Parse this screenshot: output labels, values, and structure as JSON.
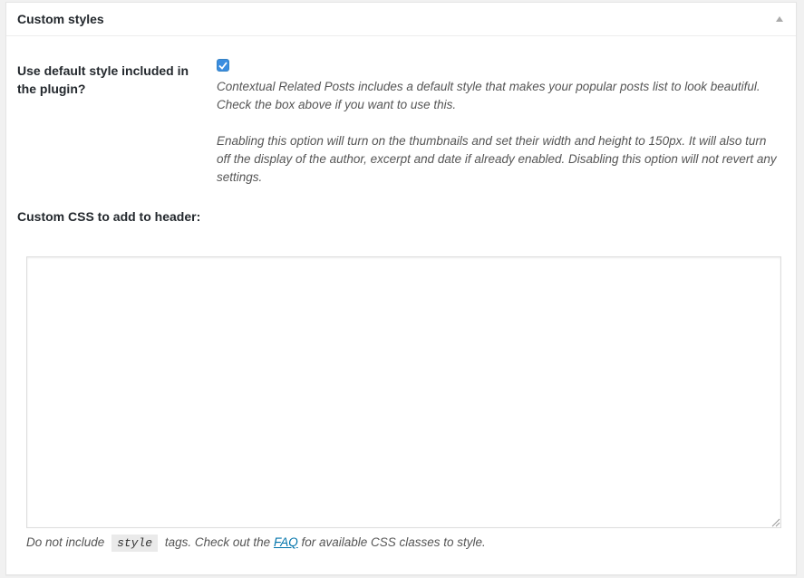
{
  "panel": {
    "title": "Custom styles",
    "toggle_icon": "caret-up-icon"
  },
  "fields": {
    "default_style": {
      "label": "Use default style included in the plugin?",
      "checked": true,
      "description_1": "Contextual Related Posts includes a default style that makes your popular posts list to look beautiful. Check the box above if you want to use this.",
      "description_2": "Enabling this option will turn on the thumbnails and set their width and height to 150px. It will also turn off the display of the author, excerpt and date if already enabled. Disabling this option will not revert any settings."
    },
    "custom_css": {
      "label": "Custom CSS to add to header:",
      "value": "",
      "note_prefix": "Do not include",
      "note_code": "style",
      "note_middle": "tags. Check out the",
      "note_link": "FAQ",
      "note_suffix": "for available CSS classes to style."
    }
  },
  "colors": {
    "checkbox": "#3b8de0",
    "link": "#0073aa"
  }
}
